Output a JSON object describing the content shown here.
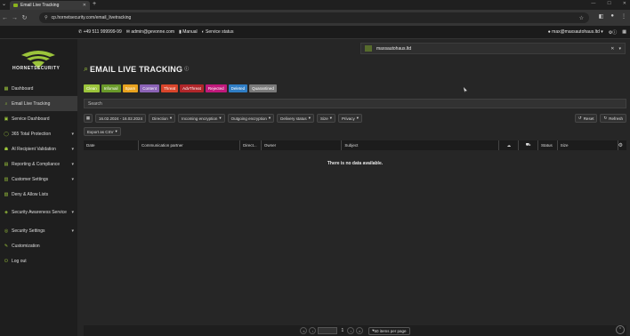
{
  "browser": {
    "tab_title": "Email Live Tracking",
    "url": "cp.hornetsecurity.com/email_livetracking"
  },
  "header": {
    "phone": "+49 511 999999-99",
    "email": "admin@gevonne.com",
    "manual": "Manual",
    "service_status": "Service status",
    "user": "max@maxsautohaus.ltd"
  },
  "logo": {
    "text": "HORNETSECURITY"
  },
  "sidebar": {
    "items": [
      {
        "label": "Dashboard",
        "icon": "dashboard-icon",
        "glyph": "▦",
        "chevron": false,
        "active": false
      },
      {
        "label": "Email Live Tracking",
        "icon": "search-icon",
        "glyph": "⌕",
        "chevron": false,
        "active": true
      },
      {
        "label": "Service Dashboard",
        "icon": "gauge-icon",
        "glyph": "▣",
        "chevron": false,
        "active": false
      },
      {
        "label": "365 Total Protection",
        "icon": "shield-icon",
        "glyph": "◯",
        "chevron": true,
        "active": false
      },
      {
        "label": "AI Recipient Validation",
        "icon": "user-check-icon",
        "glyph": "☗",
        "chevron": true,
        "active": false
      },
      {
        "label": "Reporting & Compliance",
        "icon": "chart-icon",
        "glyph": "▤",
        "chevron": true,
        "active": false
      },
      {
        "label": "Customer Settings",
        "icon": "customer-icon",
        "glyph": "▥",
        "chevron": true,
        "active": false
      },
      {
        "label": "Deny & Allow Lists",
        "icon": "list-icon",
        "glyph": "▧",
        "chevron": false,
        "active": false
      },
      {
        "label": "Security Awareness Service",
        "icon": "awareness-icon",
        "glyph": "◈",
        "chevron": true,
        "active": false
      },
      {
        "label": "Security Settings",
        "icon": "lock-shield-icon",
        "glyph": "◎",
        "chevron": true,
        "active": false
      },
      {
        "label": "Customization",
        "icon": "brush-icon",
        "glyph": "✎",
        "chevron": false,
        "active": false
      },
      {
        "label": "Log out",
        "icon": "logout-icon",
        "glyph": "⏻",
        "chevron": false,
        "active": false
      }
    ]
  },
  "domain_selector": {
    "value": "maxsautohaus.ltd"
  },
  "page": {
    "title": "EMAIL LIVE TRACKING"
  },
  "filters": [
    {
      "label": "Clean",
      "color": "#9bc43b"
    },
    {
      "label": "Infomail",
      "color": "#6a9a2a"
    },
    {
      "label": "Spam",
      "color": "#e8a21e"
    },
    {
      "label": "Content",
      "color": "#8b63b6"
    },
    {
      "label": "Threat",
      "color": "#d9452b"
    },
    {
      "label": "AdvThreat",
      "color": "#b0262a"
    },
    {
      "label": "Rejected",
      "color": "#c0197b"
    },
    {
      "label": "Deleted",
      "color": "#2f7dc4"
    },
    {
      "label": "Quarantined",
      "color": "#7a7a7a"
    }
  ],
  "search": {
    "placeholder": "Search"
  },
  "toolbar": {
    "date_range": "16.02.2024 - 16.02.2024",
    "direction": "Direction",
    "incoming": "Incoming encryption",
    "outgoing": "Outgoing encryption",
    "delivery": "Delivery status",
    "size": "Size",
    "privacy": "Privacy",
    "reset": "Reset",
    "refresh": "Refresh",
    "export": "Export as CSV"
  },
  "table": {
    "columns": [
      "Date",
      "Communication partner",
      "Direct...",
      "Owner",
      "Subject",
      "",
      "",
      "Status",
      "Size"
    ],
    "empty_message": "There is no data available."
  },
  "pager": {
    "page": "1",
    "per_page": "50 items per page"
  }
}
